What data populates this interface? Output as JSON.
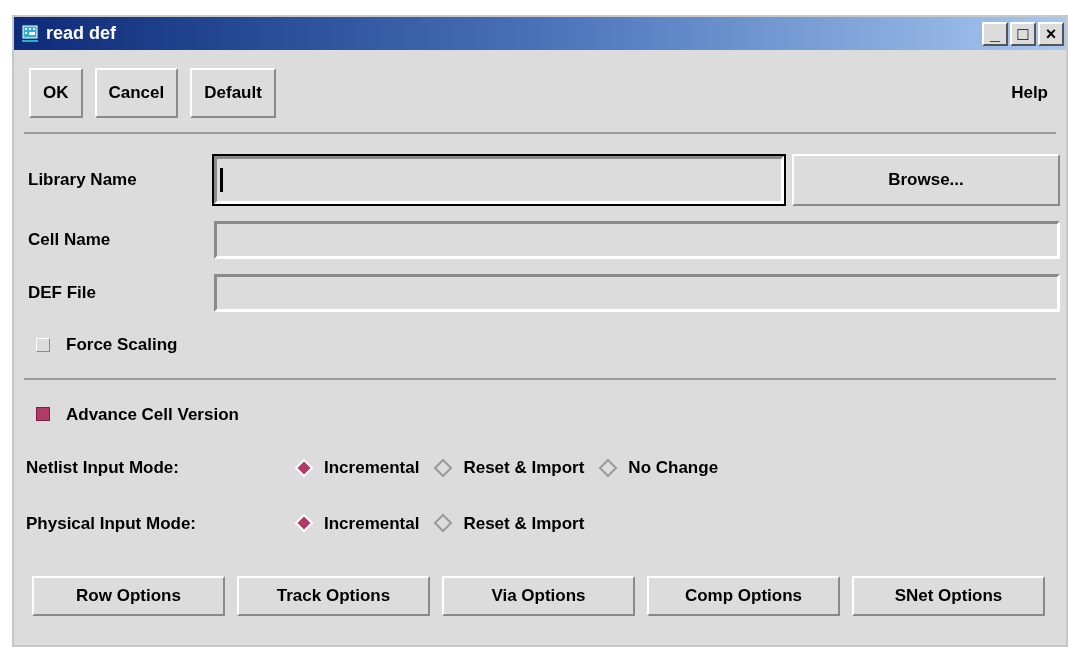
{
  "window": {
    "title": "read def"
  },
  "title_buttons": [
    "_",
    "□",
    "×"
  ],
  "top_buttons": [
    "OK",
    "Cancel",
    "Default"
  ],
  "help": "Help",
  "fields": [
    {
      "label": "Library Name",
      "focused": true,
      "button": "Browse..."
    },
    {
      "label": "Cell Name",
      "focused": false
    },
    {
      "label": "DEF File",
      "focused": false
    }
  ],
  "force_scaling": {
    "label": "Force Scaling",
    "checked": false
  },
  "advance_cell_version": {
    "label": "Advance Cell Version",
    "checked": true
  },
  "radio_groups": [
    {
      "label": "Netlist Input Mode:",
      "options": [
        {
          "label": "Incremental",
          "selected": true
        },
        {
          "label": "Reset & Import",
          "selected": false
        },
        {
          "label": "No Change",
          "selected": false
        }
      ]
    },
    {
      "label": "Physical Input Mode:",
      "options": [
        {
          "label": "Incremental",
          "selected": true
        },
        {
          "label": "Reset & Import",
          "selected": false
        }
      ]
    }
  ],
  "option_buttons": [
    "Row Options",
    "Track Options",
    "Via Options",
    "Comp Options",
    "SNet Options"
  ]
}
